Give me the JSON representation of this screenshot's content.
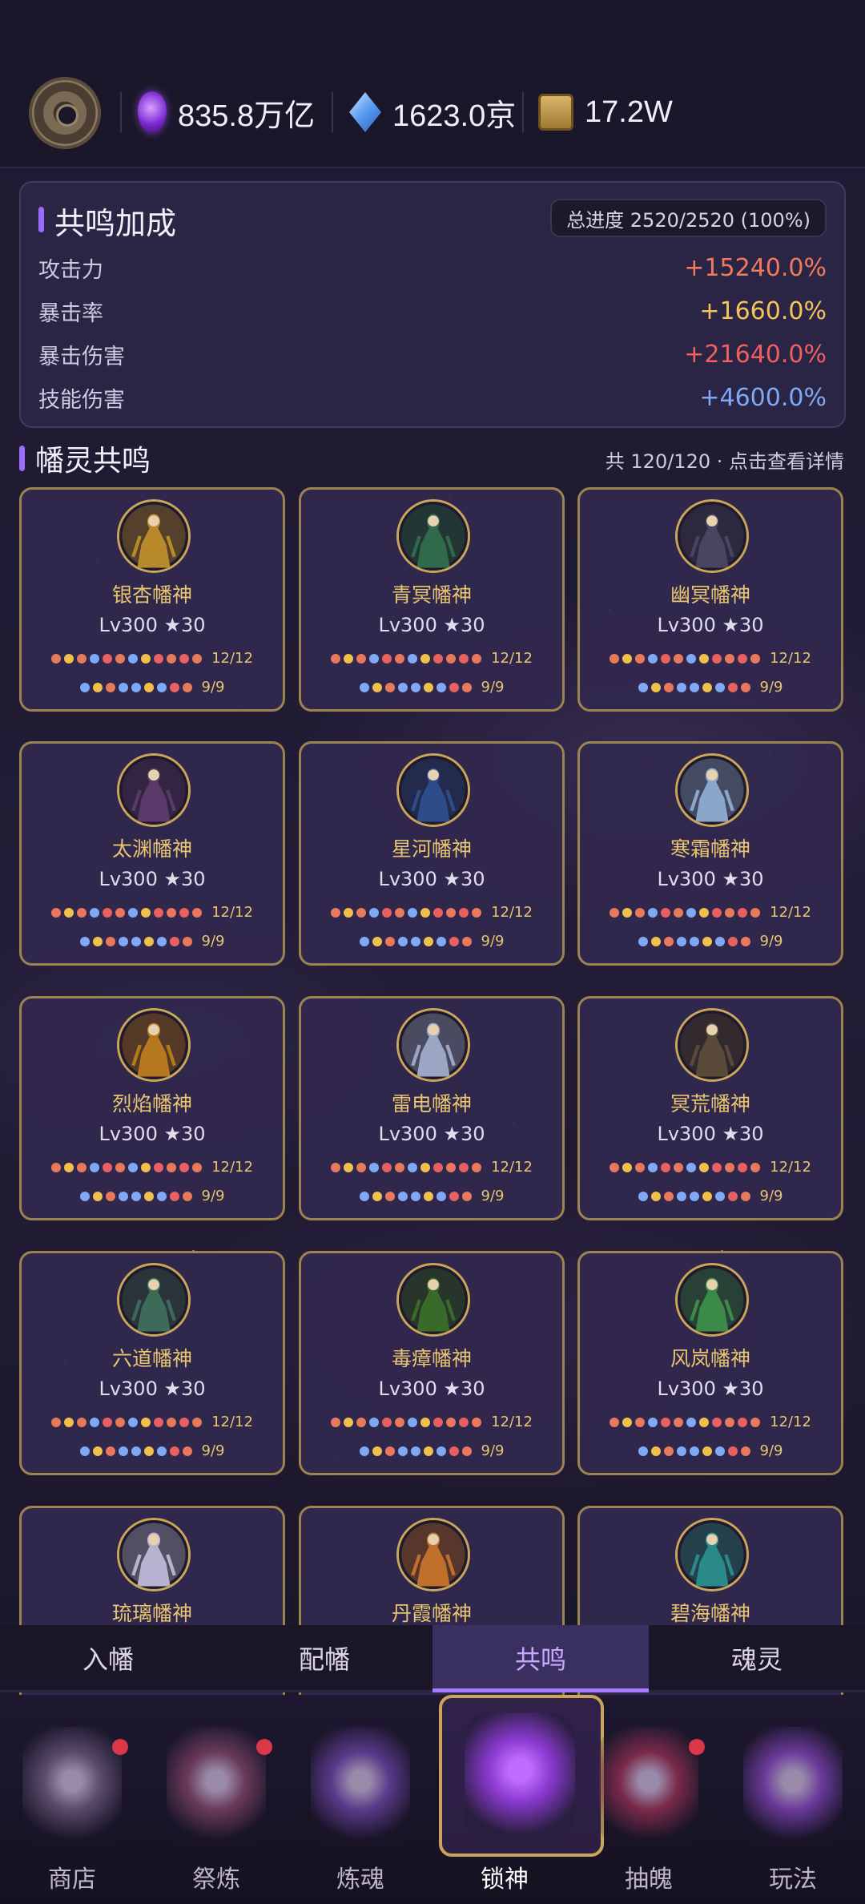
{
  "resources": {
    "soul": "835.8万亿",
    "gem": "1623.0京",
    "scroll": "17.2W"
  },
  "bonus": {
    "title": "共鸣加成",
    "progress": "总进度 2520/2520 (100%)",
    "stats": [
      {
        "label": "攻击力",
        "value": "+15240.0%",
        "color": "#f07a5c"
      },
      {
        "label": "暴击率",
        "value": "+1660.0%",
        "color": "#f5c35a"
      },
      {
        "label": "暴击伤害",
        "value": "+21640.0%",
        "color": "#ef5f5f"
      },
      {
        "label": "技能伤害",
        "value": "+4600.0%",
        "color": "#7fa8f5"
      }
    ]
  },
  "section": {
    "title": "幡灵共鸣",
    "summary": "共 120/120 · 点击查看详情"
  },
  "cards": [
    {
      "name": "银杏幡神",
      "level": "Lv300 ★30",
      "count_a": "12/12",
      "count_b": "9/9",
      "palette": "#b88a2a"
    },
    {
      "name": "青冥幡神",
      "level": "Lv300 ★30",
      "count_a": "12/12",
      "count_b": "9/9",
      "palette": "#2f6a4a"
    },
    {
      "name": "幽冥幡神",
      "level": "Lv300 ★30",
      "count_a": "12/12",
      "count_b": "9/9",
      "palette": "#4b4460"
    },
    {
      "name": "太渊幡神",
      "level": "Lv300 ★30",
      "count_a": "12/12",
      "count_b": "9/9",
      "palette": "#5a3a6a"
    },
    {
      "name": "星河幡神",
      "level": "Lv300 ★30",
      "count_a": "12/12",
      "count_b": "9/9",
      "palette": "#2c4c8a"
    },
    {
      "name": "寒霜幡神",
      "level": "Lv300 ★30",
      "count_a": "12/12",
      "count_b": "9/9",
      "palette": "#8aa6c8"
    },
    {
      "name": "烈焰幡神",
      "level": "Lv300 ★30",
      "count_a": "12/12",
      "count_b": "9/9",
      "palette": "#b6781e"
    },
    {
      "name": "雷电幡神",
      "level": "Lv300 ★30",
      "count_a": "12/12",
      "count_b": "9/9",
      "palette": "#9aa6c4"
    },
    {
      "name": "冥荒幡神",
      "level": "Lv300 ★30",
      "count_a": "12/12",
      "count_b": "9/9",
      "palette": "#5a4a3a"
    },
    {
      "name": "六道幡神",
      "level": "Lv300 ★30",
      "count_a": "12/12",
      "count_b": "9/9",
      "palette": "#3e6a5a"
    },
    {
      "name": "毒瘴幡神",
      "level": "Lv300 ★30",
      "count_a": "12/12",
      "count_b": "9/9",
      "palette": "#3a6a2a"
    },
    {
      "name": "风岚幡神",
      "level": "Lv300 ★30",
      "count_a": "12/12",
      "count_b": "9/9",
      "palette": "#3c8a4a"
    },
    {
      "name": "琉璃幡神",
      "level": "",
      "count_a": "",
      "count_b": "",
      "palette": "#b8b2d0"
    },
    {
      "name": "丹霞幡神",
      "level": "",
      "count_a": "",
      "count_b": "",
      "palette": "#c0702a"
    },
    {
      "name": "碧海幡神",
      "level": "",
      "count_a": "",
      "count_b": "",
      "palette": "#2a8a8a"
    }
  ],
  "dot_colors": {
    "row_a": [
      "#e8795a",
      "#f0c04a",
      "#e8795a",
      "#7fa8f5",
      "#e86060",
      "#e8795a",
      "#7fa8f5",
      "#f0c04a",
      "#e86060",
      "#e8795a",
      "#e86060",
      "#e8795a"
    ],
    "row_b": [
      "#7fa8f5",
      "#f0c04a",
      "#e8795a",
      "#7fa8f5",
      "#7fa8f5",
      "#f0c04a",
      "#7fa8f5",
      "#e86060",
      "#e8795a"
    ]
  },
  "tabs": [
    {
      "label": "入幡",
      "active": false
    },
    {
      "label": "配幡",
      "active": false
    },
    {
      "label": "共鸣",
      "active": true
    },
    {
      "label": "魂灵",
      "active": false
    }
  ],
  "nav": [
    {
      "label": "商店",
      "icon": "shop-icon",
      "badge": true,
      "active": false,
      "tint": "#5a4a6a"
    },
    {
      "label": "祭炼",
      "icon": "ritual-icon",
      "badge": true,
      "active": false,
      "tint": "#6a3a5a"
    },
    {
      "label": "炼魂",
      "icon": "soul-refine-icon",
      "badge": false,
      "active": false,
      "tint": "#5a3a8a"
    },
    {
      "label": "锁神",
      "icon": "lock-god-icon",
      "badge": false,
      "active": true,
      "tint": "#8a3ad0"
    },
    {
      "label": "抽魄",
      "icon": "extract-icon",
      "badge": true,
      "active": false,
      "tint": "#7a2a4a"
    },
    {
      "label": "玩法",
      "icon": "gameplay-icon",
      "badge": false,
      "active": false,
      "tint": "#6a3a9a"
    }
  ]
}
